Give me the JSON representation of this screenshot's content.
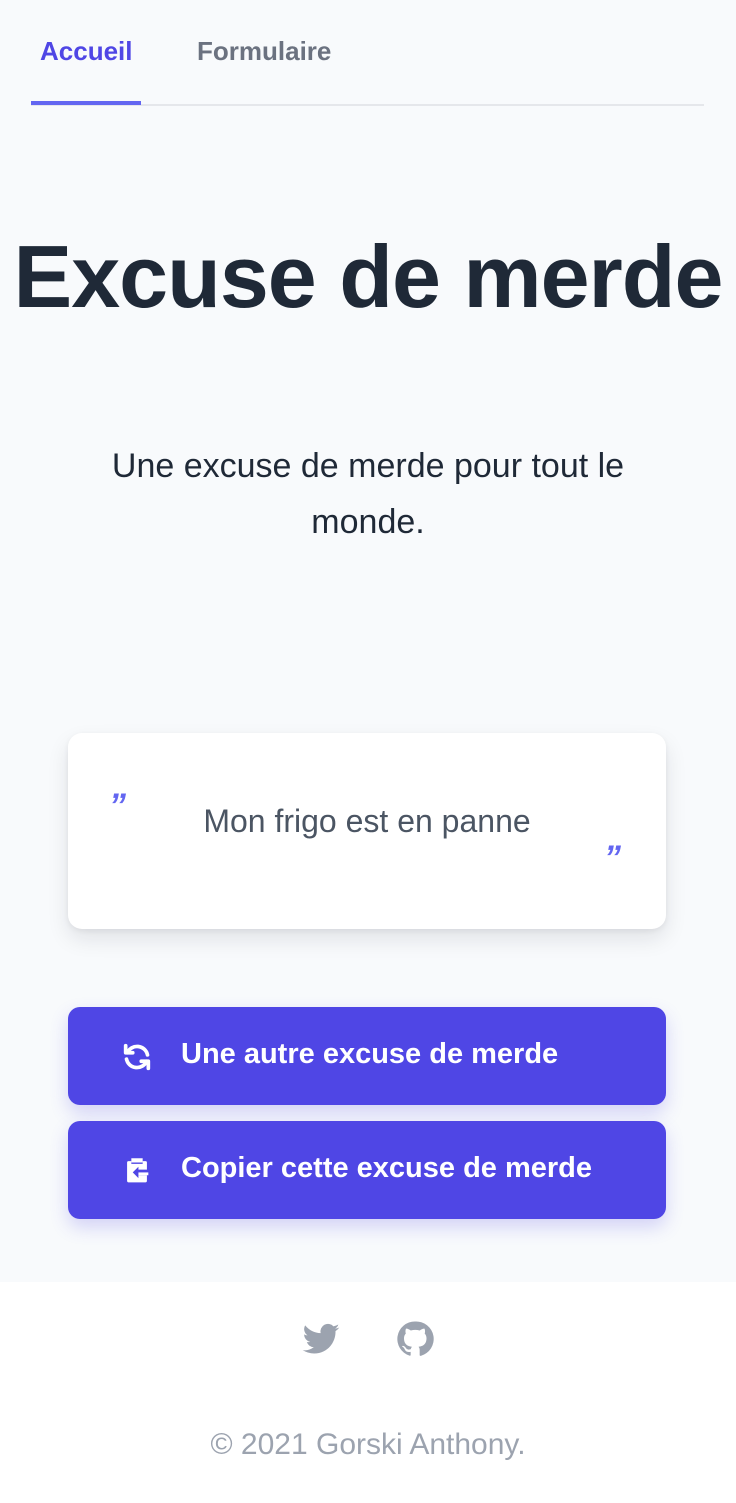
{
  "nav": {
    "tabs": [
      {
        "label": "Accueil",
        "active": true
      },
      {
        "label": "Formulaire",
        "active": false
      }
    ]
  },
  "hero": {
    "title": "Excuse de merde",
    "subtitle": "Une excuse de merde pour tout le monde."
  },
  "excuse": {
    "open_quote": "”",
    "text": "Mon frigo est en panne",
    "close_quote": "”"
  },
  "actions": {
    "another_label": "Une autre excuse de merde",
    "another_icon": "refresh-icon",
    "copy_label": "Copier cette excuse de merde",
    "copy_icon": "clipboard-copy-icon"
  },
  "footer": {
    "social": [
      "twitter-icon",
      "github-icon"
    ],
    "copyright": "© 2021 Gorski Anthony."
  },
  "colors": {
    "accent": "#4f46e5",
    "background": "#f8fafc",
    "heading": "#1f2937",
    "muted": "#9ca3af"
  }
}
